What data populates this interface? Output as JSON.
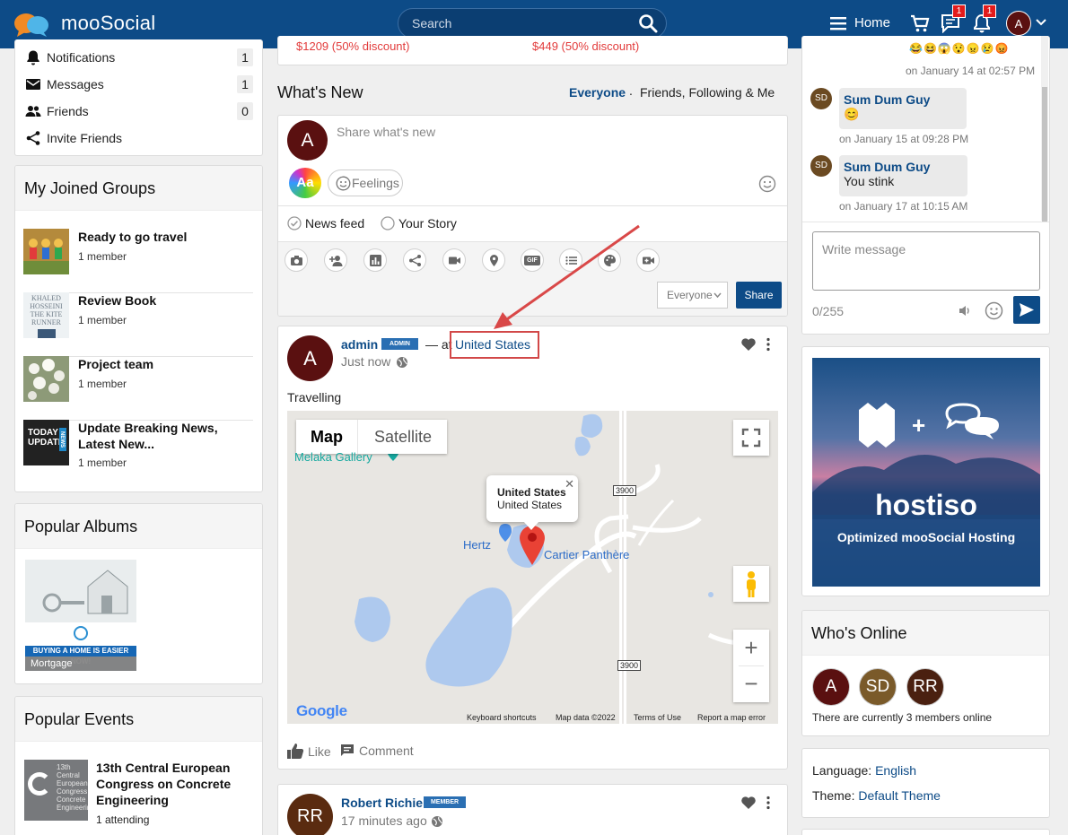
{
  "header": {
    "brand": "mooSocial",
    "search_placeholder": "Search",
    "home_label": "Home",
    "messages_badge": "1",
    "notifications_badge": "1",
    "avatar_initial": "A",
    "bar_color": "#0d4b87"
  },
  "left_menu": {
    "items": [
      {
        "label": "Notifications",
        "count": "1",
        "icon": "bell-icon"
      },
      {
        "label": "Messages",
        "count": "1",
        "icon": "envelope-icon"
      },
      {
        "label": "Friends",
        "count": "0",
        "icon": "people-icon"
      },
      {
        "label": "Invite Friends",
        "count": "",
        "icon": "share-icon"
      }
    ]
  },
  "joined_groups": {
    "title": "My Joined Groups",
    "items": [
      {
        "name": "Ready to go travel",
        "members": "1 member"
      },
      {
        "name": "Review Book",
        "members": "1 member",
        "thumb_text": [
          "KHALED",
          "HOSSEINI",
          "THE KITE",
          "RUNNER"
        ]
      },
      {
        "name": "Project team",
        "members": "1 member"
      },
      {
        "name": "Update Breaking News, Latest New...",
        "members": "1 member",
        "thumb_text": [
          "TODAY",
          "UPDATE",
          "NEWS"
        ]
      }
    ]
  },
  "popular_albums": {
    "title": "Popular Albums",
    "album_caption": "Mortgage",
    "album_banner": "BUYING A HOME IS EASIER NOW!"
  },
  "popular_events": {
    "title": "Popular Events",
    "event_title": "13th Central European Congress on Concrete Engineering",
    "attending": "1 attending",
    "thumb_text": [
      "13th",
      "Central",
      "European",
      "Congress",
      "Concrete",
      "Engineering"
    ]
  },
  "offer_strip": {
    "price1": "$1209 (50% discount)",
    "price2": "$449 (50% discount)"
  },
  "whats_new": {
    "title": "What's New",
    "filter_everyone": "Everyone",
    "filter_sep": ".",
    "filter_friends": "Friends, Following & Me",
    "composer": {
      "avatar": "A",
      "placeholder": "Share what's new",
      "text_style_label": "Aa",
      "feelings_label": "Feelings",
      "opt_newsfeed": "News feed",
      "opt_story": "Your Story",
      "privacy": "Everyone",
      "share_label": "Share",
      "tools": [
        "camera-icon",
        "add-user-icon",
        "chart-icon",
        "share-icon",
        "video-icon",
        "location-pin-icon",
        "gif-icon",
        "list-icon",
        "palette-icon",
        "video-plus-icon"
      ],
      "gif_label": "GIF"
    }
  },
  "post1": {
    "avatar": "A",
    "author": "admin",
    "role": "ADMIN",
    "at_text": "— at",
    "location": "United States",
    "time": "Just now",
    "body": "Travelling",
    "like": "Like",
    "comment": "Comment",
    "map": {
      "tab_map": "Map",
      "tab_satellite": "Satellite",
      "poi_gallery": "Melaka Gallery",
      "popup_title": "United States",
      "popup_sub": "United States",
      "poi_hertz": "Hertz",
      "poi_cartier": "Cartier Panthère",
      "road1": "3900",
      "road2": "3900",
      "google": "Google",
      "footer": [
        "Keyboard shortcuts",
        "Map data ©2022",
        "Terms of Use",
        "Report a map error"
      ]
    }
  },
  "post2": {
    "avatar": "RR",
    "author": "Robert Richie",
    "role": "MEMBER",
    "time": "17 minutes ago"
  },
  "chat": {
    "top_time": "on January 14 at 02:57 PM",
    "messages": [
      {
        "avatar": "SD",
        "name": "Sum Dum Guy",
        "text": "😊",
        "time": "on January 15 at 09:28 PM"
      },
      {
        "avatar": "SD",
        "name": "Sum Dum Guy",
        "text": "You stink",
        "time": "on January 17 at 10:15 AM"
      }
    ],
    "placeholder": "Write message",
    "counter": "0/255"
  },
  "ad": {
    "brand": "hostiso",
    "tagline": "Optimized mooSocial Hosting",
    "plus": "+"
  },
  "whos_online": {
    "title": "Who's Online",
    "avatars": [
      "A",
      "SD",
      "RR"
    ],
    "summary": "There are currently 3 members online"
  },
  "settings": {
    "language_label": "Language:",
    "language_value": "English",
    "theme_label": "Theme:",
    "theme_value": "Default Theme"
  }
}
